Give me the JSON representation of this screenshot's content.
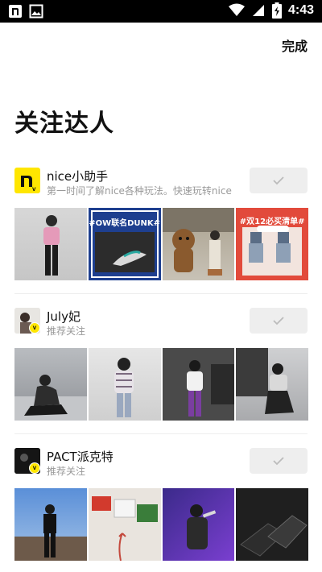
{
  "status_bar": {
    "time": "4:43",
    "left_icons": [
      "app-notification-icon",
      "image-notification-icon"
    ],
    "right_icons": [
      "wifi-icon",
      "signal-icon",
      "battery-icon"
    ]
  },
  "header": {
    "done_label": "完成",
    "title": "关注达人"
  },
  "sections": [
    {
      "name": "nice小助手",
      "desc": "第一时间了解nice各种玩法。快速玩转nice",
      "photo_captions": [
        "",
        "#OW联名DUNK#",
        "",
        "#双12必买清单#"
      ]
    },
    {
      "name": "July妃",
      "desc": "推荐关注",
      "photo_captions": [
        "",
        "",
        "",
        ""
      ]
    },
    {
      "name": "PACT派克特",
      "desc": "推荐关注",
      "photo_captions": [
        "",
        "",
        "",
        ""
      ]
    }
  ],
  "colors": {
    "badge": "#ffe600",
    "follow_bg": "#eeeeee",
    "check": "#bbbbbb",
    "desc_text": "#999999"
  }
}
